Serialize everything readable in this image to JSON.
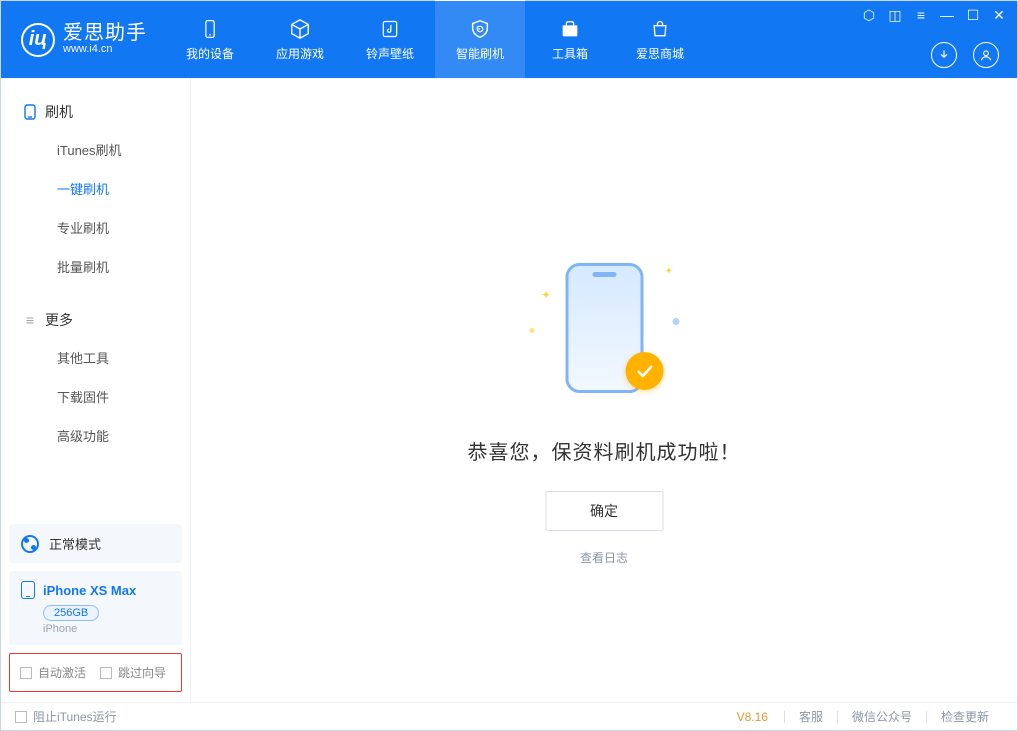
{
  "brand": {
    "name": "爱思助手",
    "url": "www.i4.cn"
  },
  "tabs": [
    {
      "label": "我的设备"
    },
    {
      "label": "应用游戏"
    },
    {
      "label": "铃声壁纸"
    },
    {
      "label": "智能刷机"
    },
    {
      "label": "工具箱"
    },
    {
      "label": "爱思商城"
    }
  ],
  "sidebar": {
    "sec1": {
      "title": "刷机",
      "items": [
        "iTunes刷机",
        "一键刷机",
        "专业刷机",
        "批量刷机"
      ]
    },
    "sec2": {
      "title": "更多",
      "items": [
        "其他工具",
        "下载固件",
        "高级功能"
      ]
    }
  },
  "mode": {
    "label": "正常模式"
  },
  "device": {
    "name": "iPhone XS Max",
    "capacity": "256GB",
    "type": "iPhone"
  },
  "opts": {
    "auto_activate": "自动激活",
    "skip_guide": "跳过向导"
  },
  "main": {
    "success_text": "恭喜您，保资料刷机成功啦！",
    "ok": "确定",
    "view_log": "查看日志"
  },
  "footer": {
    "block_itunes": "阻止iTunes运行",
    "version": "V8.16",
    "links": [
      "客服",
      "微信公众号",
      "检查更新"
    ]
  }
}
